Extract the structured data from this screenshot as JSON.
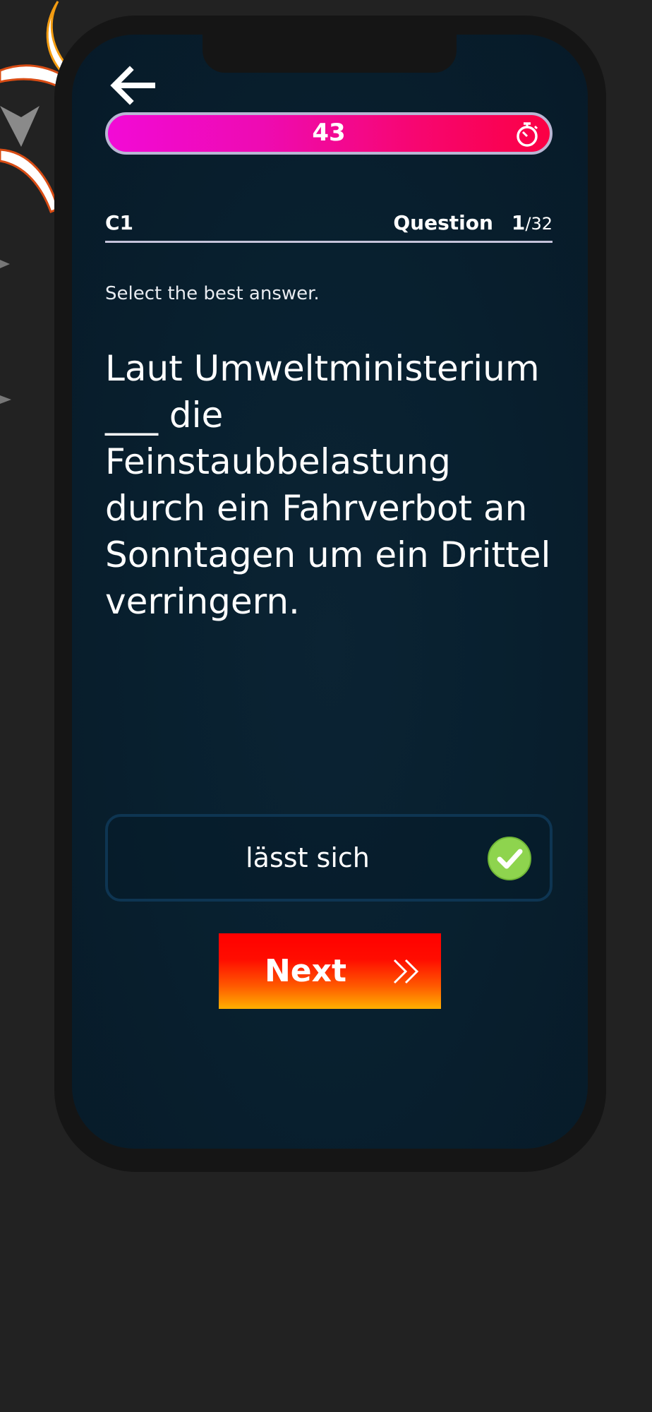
{
  "timer": {
    "value": "43"
  },
  "quiz": {
    "level": "C1",
    "question_label": "Question",
    "question_current": "1",
    "question_total": "/32",
    "instruction": "Select the best answer.",
    "question_text": "Laut Umweltministerium ___ die Feinstaubbelastung durch ein Fahrverbot an Sonntagen um ein Drittel verringern."
  },
  "answer": {
    "text": "lässt sich",
    "status": "correct"
  },
  "next_button": {
    "label": "Next"
  },
  "colors": {
    "background": "#222222",
    "screen": "#08202f",
    "timer_gradient_start": "#f20ad6",
    "timer_gradient_end": "#fb0044",
    "check_green": "#8ed44e",
    "next_gradient_top": "#ff0000",
    "next_gradient_bottom": "#ffb000"
  },
  "icons": {
    "back": "back-arrow-icon",
    "timer": "stopwatch-icon",
    "answer_status": "check-circle-icon",
    "next": "double-chevron-right-icon"
  }
}
